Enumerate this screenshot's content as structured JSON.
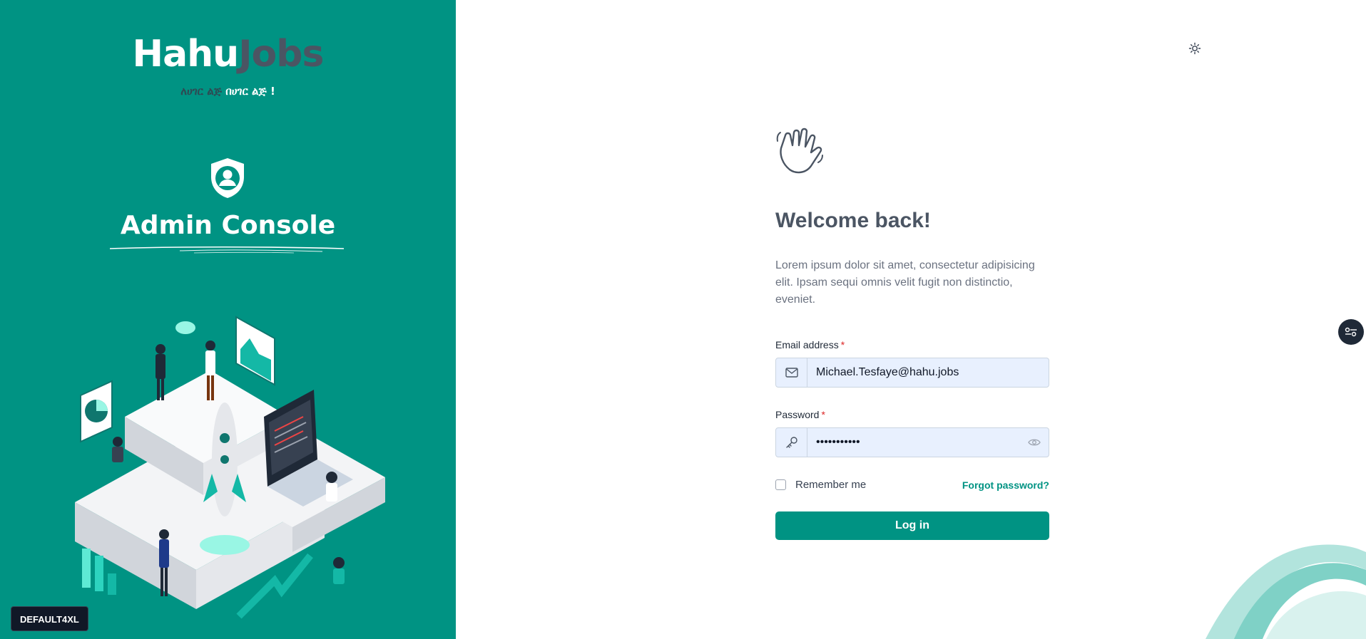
{
  "brand": {
    "logo_part1": "Hahu",
    "logo_part2": "Jobs",
    "tagline_part1": "ለሀገር ልጅ",
    "tagline_part2": "በሀገር ልጅ !",
    "panel_color": "#009383"
  },
  "sidebar": {
    "title": "Admin Console",
    "env_badge": "DEFAULT4XL"
  },
  "login": {
    "heading": "Welcome back!",
    "description": "Lorem ipsum dolor sit amet, consectetur adipisicing elit. Ipsam sequi omnis velit fugit non distinctio, eveniet.",
    "email_label": "Email address",
    "email_value": "Michael.Tesfaye@hahu.jobs",
    "password_label": "Password",
    "password_value": "•••••••••••",
    "required_marker": "*",
    "remember_label": "Remember me",
    "forgot_label": "Forgot password?",
    "submit_label": "Log in"
  },
  "icons": {
    "shield": "shield-user-icon",
    "wave": "waving-hand-icon",
    "email": "mail-icon",
    "password": "key-icon",
    "toggle_visibility": "eye-icon",
    "theme": "sun-icon",
    "fab": "settings-toggle-icon"
  }
}
